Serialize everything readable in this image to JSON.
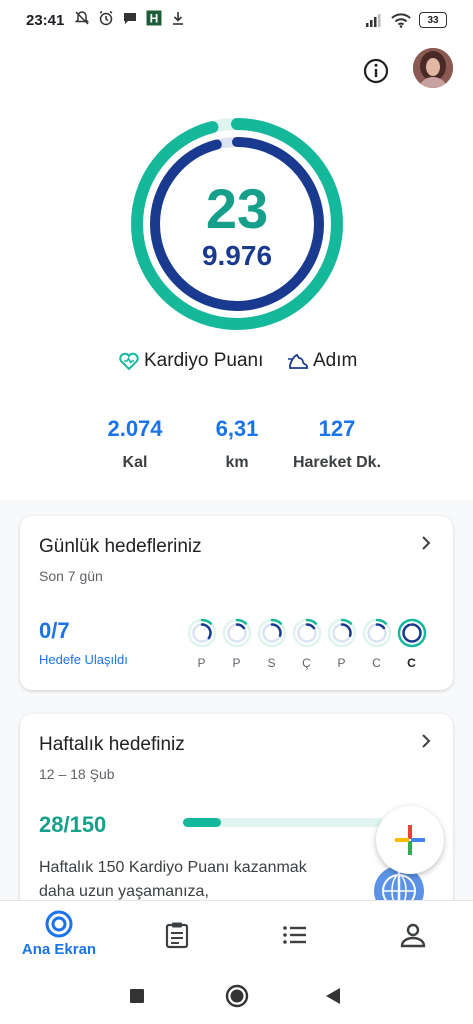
{
  "status_bar": {
    "time": "23:41",
    "battery": "33",
    "icons": [
      "mute-bell-icon",
      "alarm-icon",
      "chat-bubble-icon",
      "app-h-icon",
      "download-icon",
      "signal-icon",
      "wifi-icon",
      "battery-icon"
    ]
  },
  "top_bar": {
    "icons": [
      "info-icon",
      "avatar"
    ]
  },
  "summary": {
    "cardio_points": "23",
    "steps": "9.976",
    "cardio_label": "Kardiyo Puanı",
    "steps_label": "Adım",
    "cardio_progress": 0.96,
    "steps_progress": 0.96
  },
  "stats": [
    {
      "value": "2.074",
      "label": "Kal"
    },
    {
      "value": "6,31",
      "label": "km"
    },
    {
      "value": "127",
      "label": "Hareket Dk."
    }
  ],
  "daily_goals": {
    "title": "Günlük hedefleriniz",
    "subtitle": "Son 7 gün",
    "value": "0/7",
    "value_label": "Hedefe Ulaşıldı",
    "days": [
      {
        "label": "P",
        "progress": 0.35
      },
      {
        "label": "P",
        "progress": 0.15
      },
      {
        "label": "S",
        "progress": 0.3
      },
      {
        "label": "Ç",
        "progress": 0.15
      },
      {
        "label": "P",
        "progress": 0.3
      },
      {
        "label": "C",
        "progress": 0.15
      },
      {
        "label": "C",
        "progress": 0.95
      }
    ]
  },
  "weekly_goal": {
    "title": "Haftalık hedefiniz",
    "subtitle": "12 – 18 Şub",
    "value": "28/150",
    "progress": 0.19,
    "description": "Haftalık 150 Kardiyo Puanı kazanmak daha uzun yaşamanıza,"
  },
  "bottom_nav": {
    "items": [
      {
        "label": "Ana Ekran",
        "icon": "home-rings-icon",
        "active": true
      },
      {
        "label": "",
        "icon": "journal-icon"
      },
      {
        "label": "",
        "icon": "list-icon"
      },
      {
        "label": "",
        "icon": "profile-icon"
      }
    ]
  },
  "colors": {
    "cardio": "#16b89c",
    "steps": "#1a3a8f",
    "accent_blue": "#1a73e8"
  }
}
